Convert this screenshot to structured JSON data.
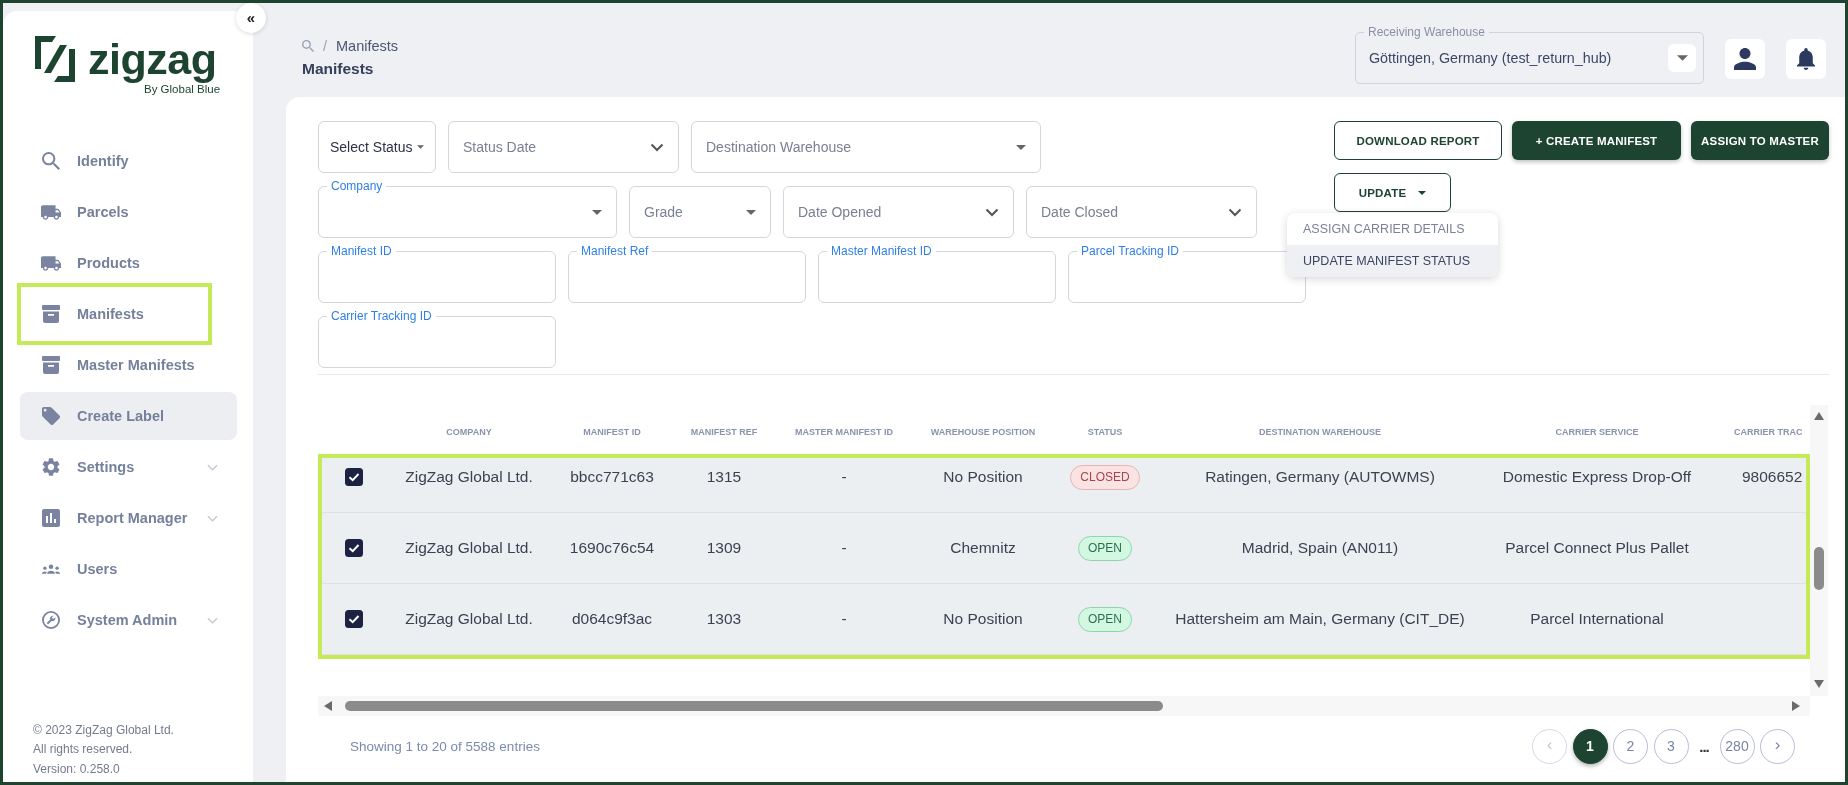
{
  "sidebar": {
    "collapse_button": "«",
    "logo": {
      "wordmark": "zigzag",
      "tagline": "By Global Blue"
    },
    "items": [
      {
        "label": "Identify",
        "kind": "link",
        "hovered": false,
        "annotated": false
      },
      {
        "label": "Parcels",
        "kind": "link",
        "hovered": false,
        "annotated": false
      },
      {
        "label": "Products",
        "kind": "link",
        "hovered": false,
        "annotated": false
      },
      {
        "label": "Manifests",
        "kind": "link",
        "hovered": false,
        "annotated": true
      },
      {
        "label": "Master Manifests",
        "kind": "link",
        "hovered": false,
        "annotated": false
      },
      {
        "label": "Create Label",
        "kind": "link",
        "hovered": true,
        "annotated": false
      },
      {
        "label": "Settings",
        "kind": "group",
        "hovered": false,
        "annotated": false
      },
      {
        "label": "Report Manager",
        "kind": "group",
        "hovered": false,
        "annotated": false
      },
      {
        "label": "Users",
        "kind": "link",
        "hovered": false,
        "annotated": false
      },
      {
        "label": "System Admin",
        "kind": "group",
        "hovered": false,
        "annotated": false
      }
    ],
    "footer": [
      "© 2023 ZigZag Global Ltd.",
      "All rights reserved.",
      "Version: 0.258.0"
    ]
  },
  "header": {
    "breadcrumb": {
      "separator": "/",
      "current": "Manifests"
    },
    "title": "Manifests",
    "receiving_warehouse": {
      "label": "Receiving Warehouse",
      "value": "Göttingen, Germany (test_return_hub)"
    }
  },
  "filters": {
    "rows": [
      [
        {
          "kind": "native-select",
          "value": "Select Status"
        },
        {
          "kind": "date",
          "placeholder": "Status Date"
        },
        {
          "kind": "select",
          "placeholder": "Destination Warehouse"
        }
      ],
      [
        {
          "kind": "select",
          "label": "Company"
        },
        {
          "kind": "select",
          "placeholder": "Grade"
        },
        {
          "kind": "date",
          "placeholder": "Date Opened"
        },
        {
          "kind": "date",
          "placeholder": "Date Closed"
        }
      ],
      [
        {
          "kind": "text",
          "label": "Manifest ID"
        },
        {
          "kind": "text",
          "label": "Manifest Ref"
        },
        {
          "kind": "text",
          "label": "Master Manifest ID"
        },
        {
          "kind": "text",
          "label": "Parcel Tracking ID"
        }
      ],
      [
        {
          "kind": "text",
          "label": "Carrier Tracking ID"
        }
      ]
    ]
  },
  "actions": {
    "buttons": [
      {
        "label": "DOWNLOAD REPORT",
        "kind": "outlined"
      },
      {
        "label": "+ CREATE MANIFEST",
        "kind": "filled"
      },
      {
        "label": "ASSIGN TO MASTER",
        "kind": "filled"
      }
    ],
    "update_button": {
      "label": "UPDATE"
    },
    "update_menu": [
      {
        "label": "ASSIGN CARRIER DETAILS",
        "hovered": false
      },
      {
        "label": "UPDATE MANIFEST STATUS",
        "hovered": true
      }
    ]
  },
  "table": {
    "columns": [
      "COMPANY",
      "MANIFEST ID",
      "MANIFEST REF",
      "MASTER MANIFEST ID",
      "WAREHOUSE POSITION",
      "STATUS",
      "DESTINATION WAREHOUSE",
      "CARRIER SERVICE",
      "CARRIER TRAC"
    ],
    "rows": [
      {
        "checked": true,
        "annotated": true,
        "company": "ZigZag Global Ltd.",
        "manifest_id": "bbcc771c63",
        "manifest_ref": "1315",
        "master_manifest_id": "-",
        "warehouse_position": "No Position",
        "status": {
          "text": "CLOSED",
          "kind": "closed"
        },
        "destination_warehouse": "Ratingen, Germany (AUTOWMS)",
        "carrier_service": "Domestic Express Drop-Off",
        "column_9": "9806652"
      },
      {
        "checked": true,
        "annotated": true,
        "company": "ZigZag Global Ltd.",
        "manifest_id": "1690c76c54",
        "manifest_ref": "1309",
        "master_manifest_id": "-",
        "warehouse_position": "Chemnitz",
        "status": {
          "text": "OPEN",
          "kind": "open"
        },
        "destination_warehouse": "Madrid, Spain (AN011)",
        "carrier_service": "Parcel Connect Plus Pallet"
      },
      {
        "checked": true,
        "annotated": true,
        "company": "ZigZag Global Ltd.",
        "manifest_id": "d064c9f3ac",
        "manifest_ref": "1303",
        "master_manifest_id": "-",
        "warehouse_position": "No Position",
        "status": {
          "text": "OPEN",
          "kind": "open"
        },
        "destination_warehouse": "Hattersheim am Main, Germany (CIT_DE)",
        "carrier_service": "Parcel International"
      }
    ]
  },
  "footer": {
    "summary": "Showing 1 to 20 of 5588 entries",
    "pagination": {
      "previous": {
        "label": "‹",
        "disabled": true
      },
      "pages": [
        {
          "label": "1",
          "selected": true
        },
        {
          "label": "2",
          "selected": false
        },
        {
          "label": "3",
          "selected": false
        }
      ],
      "ellipsis": "...",
      "last": {
        "label": "280",
        "selected": false
      },
      "next": {
        "label": "›",
        "disabled": false
      }
    }
  }
}
